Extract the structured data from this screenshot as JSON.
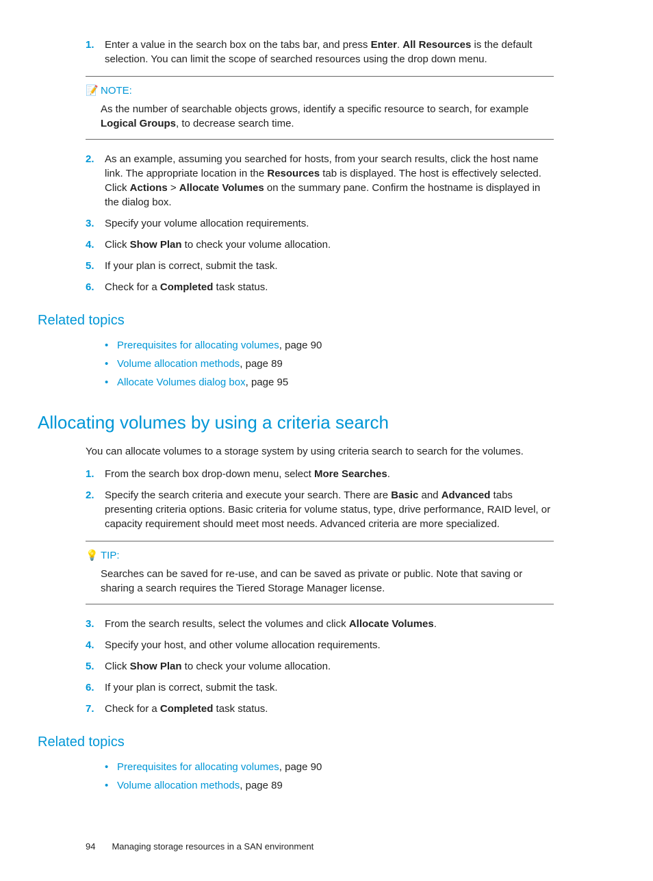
{
  "steps1": {
    "s1": {
      "num": "1.",
      "p1": "Enter a value in the search box on the tabs bar, and press ",
      "b1": "Enter",
      "p2": ". ",
      "b2": "All Resources",
      "p3": " is the default selection. You can limit the scope of searched resources using the drop down menu."
    },
    "note": {
      "label": "NOTE:",
      "p1": "As the number of searchable objects grows, identify a specific resource to search, for example ",
      "b1": "Logical Groups",
      "p2": ", to decrease search time."
    },
    "s2": {
      "num": "2.",
      "p1": "As an example, assuming you searched for hosts, from your search results, click the host name link. The appropriate location in the ",
      "b1": "Resources",
      "p2": " tab is displayed. The host is effectively selected. Click ",
      "b2": "Actions",
      "p3": " > ",
      "b3": "Allocate Volumes",
      "p4": " on the summary pane. Confirm the hostname is displayed in the dialog box."
    },
    "s3": {
      "num": "3.",
      "txt": "Specify your volume allocation requirements."
    },
    "s4": {
      "num": "4.",
      "p1": "Click ",
      "b1": "Show Plan",
      "p2": " to check your volume allocation."
    },
    "s5": {
      "num": "5.",
      "txt": "If your plan is correct, submit the task."
    },
    "s6": {
      "num": "6.",
      "p1": "Check for a ",
      "b1": "Completed",
      "p2": " task status."
    }
  },
  "related1": {
    "heading": "Related topics",
    "items": [
      {
        "link": "Prerequisites for allocating volumes",
        "suffix": ", page 90"
      },
      {
        "link": "Volume allocation methods",
        "suffix": ", page 89"
      },
      {
        "link": "Allocate Volumes dialog box",
        "suffix": ", page 95"
      }
    ]
  },
  "section2": {
    "heading": "Allocating volumes by using a criteria search",
    "intro": "You can allocate volumes to a storage system by using criteria search to search for the volumes."
  },
  "steps2": {
    "s1": {
      "num": "1.",
      "p1": "From the search box drop-down menu, select ",
      "b1": "More Searches",
      "p2": "."
    },
    "s2": {
      "num": "2.",
      "p1": "Specify the search criteria and execute your search. There are ",
      "b1": "Basic",
      "p2": " and ",
      "b2": "Advanced",
      "p3": " tabs presenting criteria options. Basic criteria for volume status, type, drive performance, RAID level, or capacity requirement should meet most needs. Advanced criteria are more specialized."
    },
    "tip": {
      "label": "TIP:",
      "txt": "Searches can be saved for re-use, and can be saved as private or public. Note that saving or sharing a search requires the Tiered Storage Manager license."
    },
    "s3": {
      "num": "3.",
      "p1": "From the search results, select the volumes and click ",
      "b1": "Allocate Volumes",
      "p2": "."
    },
    "s4": {
      "num": "4.",
      "txt": "Specify your host, and other volume allocation requirements."
    },
    "s5": {
      "num": "5.",
      "p1": "Click ",
      "b1": "Show Plan",
      "p2": " to check your volume allocation."
    },
    "s6": {
      "num": "6.",
      "txt": "If your plan is correct, submit the task."
    },
    "s7": {
      "num": "7.",
      "p1": "Check for a ",
      "b1": "Completed",
      "p2": " task status."
    }
  },
  "related2": {
    "heading": "Related topics",
    "items": [
      {
        "link": "Prerequisites for allocating volumes",
        "suffix": ", page 90"
      },
      {
        "link": "Volume allocation methods",
        "suffix": ", page 89"
      }
    ]
  },
  "footer": {
    "page": "94",
    "title": "Managing storage resources in a SAN environment"
  },
  "icons": {
    "note": "📝",
    "tip": "💡"
  }
}
